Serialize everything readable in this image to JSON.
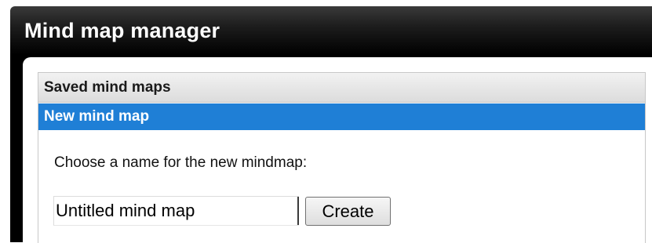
{
  "dialog": {
    "title": "Mind map manager"
  },
  "accordion": {
    "saved_header": "Saved mind maps",
    "new_header": "New mind map"
  },
  "new_map": {
    "prompt": "Choose a name for the new mindmap:",
    "name_value": "Untitled mind map",
    "create_label": "Create"
  },
  "colors": {
    "title_bar": "#000000",
    "active_header": "#1f7fd6",
    "inactive_header": "#e6e6e6"
  }
}
